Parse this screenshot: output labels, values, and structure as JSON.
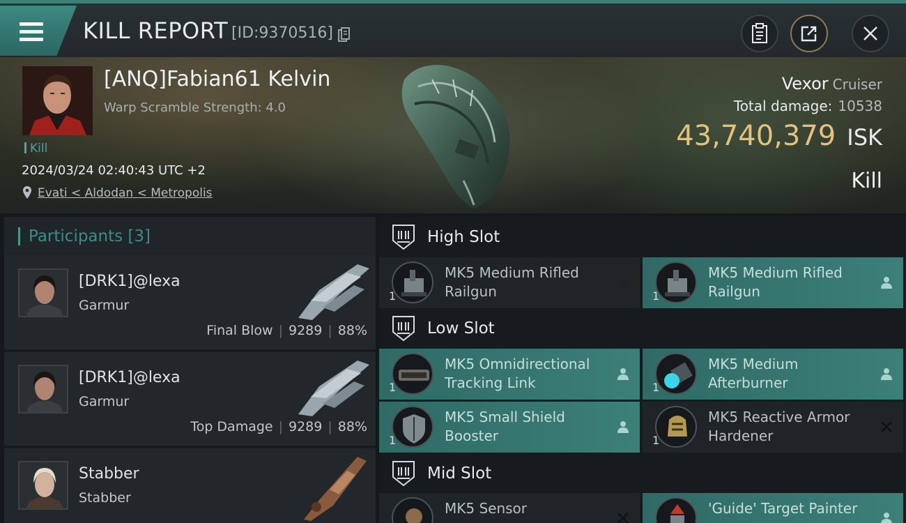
{
  "header": {
    "title": "KILL REPORT",
    "report_id": "[ID:9370516]"
  },
  "victim": {
    "name": "[ANQ]Fabian61 Kelvin",
    "warp_scramble": "Warp Scramble Strength: 4.0",
    "kill_tag": "Kill",
    "datetime": "2024/03/24 02:40:43 UTC +2",
    "location": "Evati < Aldodan < Metropolis",
    "ship_name": "Vexor",
    "ship_class": "Cruiser",
    "total_damage_label": "Total damage:",
    "total_damage": "10538",
    "isk_value": "43,740,379",
    "isk_currency": "ISK",
    "result": "Kill"
  },
  "participants": {
    "title": "Participants",
    "count": "[3]",
    "rows": [
      {
        "name": "[DRK1]@lexa",
        "ship": "Garmur",
        "role": "Final Blow",
        "damage": "9289",
        "percent": "88%"
      },
      {
        "name": "[DRK1]@lexa",
        "ship": "Garmur",
        "role": "Top Damage",
        "damage": "9289",
        "percent": "88%"
      },
      {
        "name": "Stabber",
        "ship": "Stabber",
        "role": "",
        "damage": "",
        "percent": ""
      }
    ]
  },
  "fitting": {
    "high_slot": "High Slot",
    "low_slot": "Low Slot",
    "mid_slot": "Mid Slot",
    "modules": [
      {
        "name": "MK5 Medium Rifled Railgun",
        "qty": "1",
        "status": "destroyed"
      },
      {
        "name": "MK5 Medium Rifled Railgun",
        "qty": "1",
        "status": "dropped"
      },
      {
        "name": "MK5 Omnidirectional Tracking Link",
        "qty": "1",
        "status": "dropped"
      },
      {
        "name": "MK5 Medium Afterburner",
        "qty": "1",
        "status": "dropped"
      },
      {
        "name": "MK5 Small Shield Booster",
        "qty": "1",
        "status": "dropped"
      },
      {
        "name": "MK5 Reactive Armor Hardener",
        "qty": "1",
        "status": "destroyed"
      },
      {
        "name": "MK5 Sensor",
        "qty": "1",
        "status": "destroyed"
      },
      {
        "name": "'Guide' Target Painter",
        "qty": "1",
        "status": "dropped"
      }
    ]
  },
  "icons": {
    "menu": "menu-icon",
    "copy": "copy-icon",
    "clipboard": "clipboard-icon",
    "share": "share-icon",
    "close": "close-icon",
    "location": "location-pin-icon",
    "slot": "slot-icon",
    "destroyed": "x-icon",
    "dropped": "person-icon"
  },
  "colors": {
    "accent": "#3f9a94",
    "isk": "#e3c27e",
    "fitted": "#3c7f79"
  }
}
